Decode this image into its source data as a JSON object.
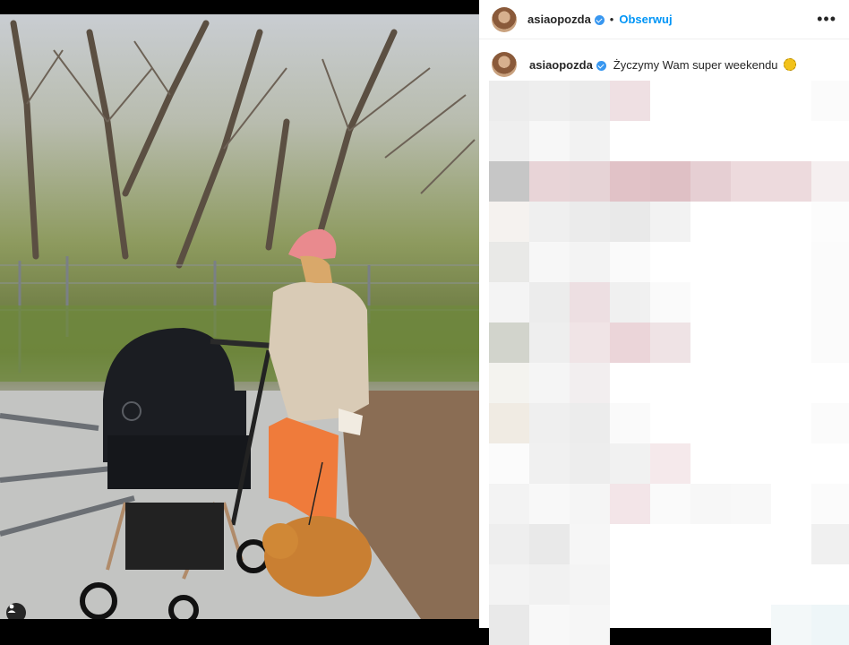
{
  "post": {
    "username": "asiaopozda",
    "dot": "•",
    "follow_label": "Obserwuj",
    "more_label": "•••"
  },
  "caption": {
    "username": "asiaopozda",
    "text": "Życzymy Wam super weekendu"
  },
  "photo": {
    "description_icon": "user-tag-icon"
  },
  "colors": {
    "follow_blue": "#0095f6",
    "verified_blue": "#3897f0",
    "text": "#262626"
  }
}
